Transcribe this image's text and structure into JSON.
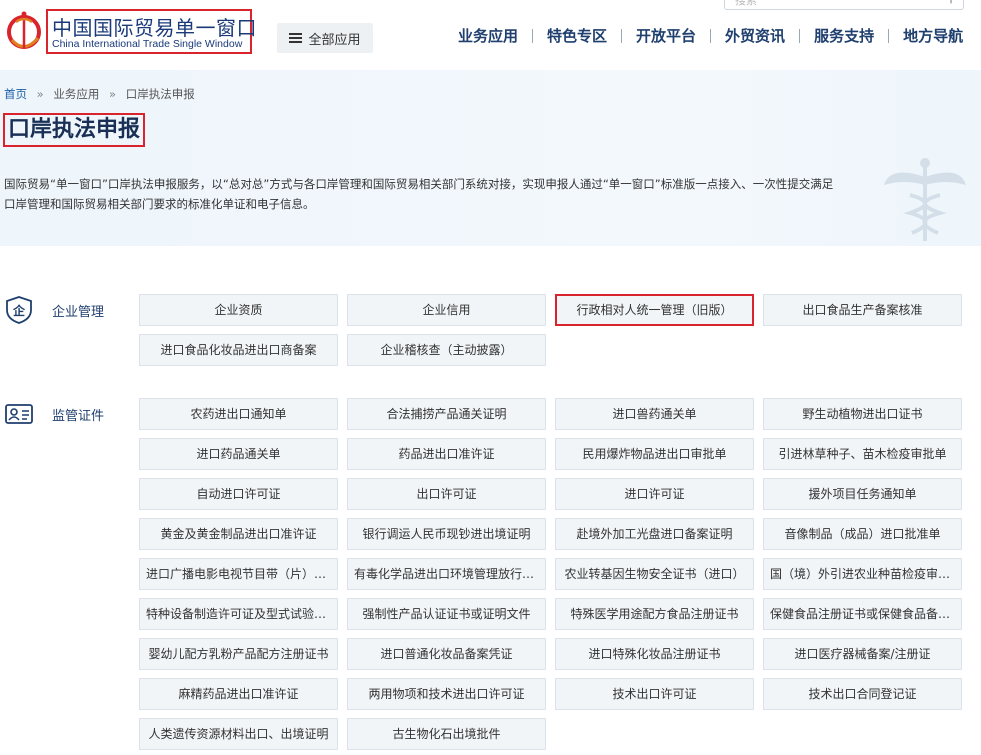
{
  "header": {
    "logo_cn": "中国国际贸易单一窗口",
    "logo_en": "China International Trade Single Window",
    "all_apps": "全部应用",
    "nav": [
      "业务应用",
      "特色专区",
      "开放平台",
      "外贸资讯",
      "服务支持",
      "地方导航"
    ],
    "search_placeholder": "搜索"
  },
  "breadcrumb": {
    "home": "首页",
    "sep": "»",
    "level1": "业务应用",
    "level2": "口岸执法申报"
  },
  "page_title": "口岸执法申报",
  "description": "国际贸易“单一窗口”口岸执法申报服务，以“总对总”方式与各口岸管理和国际贸易相关部门系统对接，实现申报人通过“单一窗口”标准版一点接入、一次性提交满足口岸管理和国际贸易相关部门要求的标准化单证和电子信息。",
  "sections": [
    {
      "label": "企业管理",
      "icon_text": "企",
      "items": [
        "企业资质",
        "企业信用",
        "行政相对人统一管理（旧版）",
        "出口食品生产备案核准",
        "进口食品化妆品进出口商备案",
        "企业稽核查（主动披露）"
      ]
    },
    {
      "label": "监管证件",
      "items": [
        "农药进出口通知单",
        "合法捕捞产品通关证明",
        "进口兽药通关单",
        "野生动植物进出口证书",
        "进口药品通关单",
        "药品进出口准许证",
        "民用爆炸物品进出口审批单",
        "引进林草种子、苗木检疫审批单",
        "自动进口许可证",
        "出口许可证",
        "进口许可证",
        "援外项目任务通知单",
        "黄金及黄金制品进出口准许证",
        "银行调运人民币现钞进出境证明",
        "赴境外加工光盘进口备案证明",
        "音像制品（成品）进口批准单",
        "进口广播电影电视节目带（片）提取单",
        "有毒化学品进出口环境管理放行通知单",
        "农业转基因生物安全证书（进口）",
        "国（境）外引进农业种苗检疫审批单",
        "特种设备制造许可证及型式试验证书",
        "强制性产品认证证书或证明文件",
        "特殊医学用途配方食品注册证书",
        "保健食品注册证书或保健食品备案凭证",
        "婴幼儿配方乳粉产品配方注册证书",
        "进口普通化妆品备案凭证",
        "进口特殊化妆品注册证书",
        "进口医疗器械备案/注册证",
        "麻精药品进出口准许证",
        "两用物项和技术进出口许可证",
        "技术出口许可证",
        "技术出口合同登记证",
        "人类遗传资源材料出口、出境证明",
        "古生物化石出境批件"
      ]
    }
  ],
  "colors": {
    "highlight": "#d9232d",
    "nav_text": "#1f3f6e",
    "tile_bg": "#f1f5f8"
  }
}
